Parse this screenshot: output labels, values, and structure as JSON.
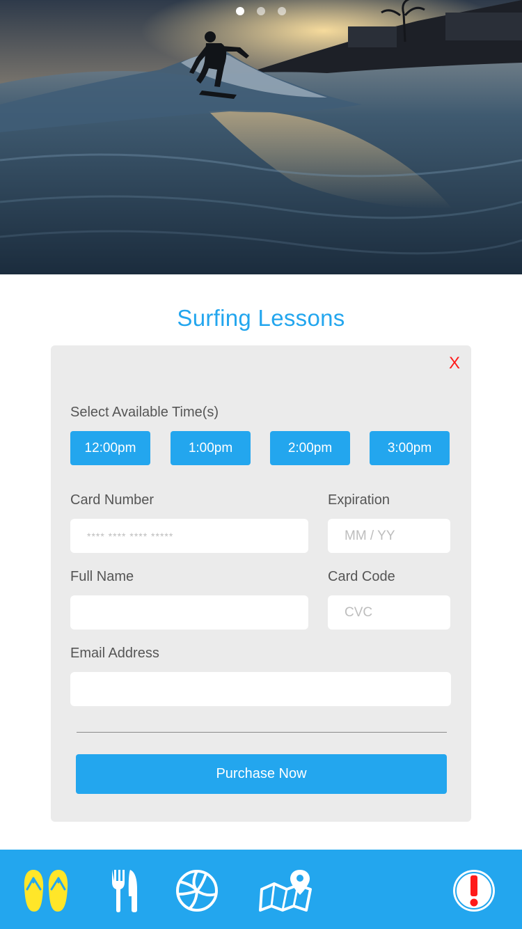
{
  "hero": {
    "image_label": "surfer-sunset-photo",
    "slides_total": 3,
    "active_slide": 1
  },
  "page": {
    "title": "Surfing Lessons"
  },
  "form": {
    "close_label": "X",
    "time_label": "Select Available Time(s)",
    "times": [
      "12:00pm",
      "1:00pm",
      "2:00pm",
      "3:00pm"
    ],
    "card_number": {
      "label": "Card Number",
      "placeholder": "**** **** **** *****",
      "value": ""
    },
    "expiration": {
      "label": "Expiration",
      "placeholder": "MM / YY",
      "value": ""
    },
    "full_name": {
      "label": "Full Name",
      "placeholder": "",
      "value": ""
    },
    "card_code": {
      "label": "Card Code",
      "placeholder": "CVC",
      "value": ""
    },
    "email": {
      "label": "Email Address",
      "placeholder": "",
      "value": ""
    },
    "purchase_label": "Purchase Now"
  },
  "tabbar": {
    "items": [
      {
        "icon": "flip-flops-icon",
        "active": true
      },
      {
        "icon": "fork-knife-icon",
        "active": false
      },
      {
        "icon": "volleyball-icon",
        "active": false
      },
      {
        "icon": "map-pin-icon",
        "active": false
      },
      {
        "icon": "alert-icon",
        "active": false
      }
    ]
  },
  "colors": {
    "accent": "#23a6ee",
    "active_tab": "#ffe629",
    "close": "#ff1a1a",
    "alert": "#ff1a1a",
    "panel": "#ebebeb"
  }
}
